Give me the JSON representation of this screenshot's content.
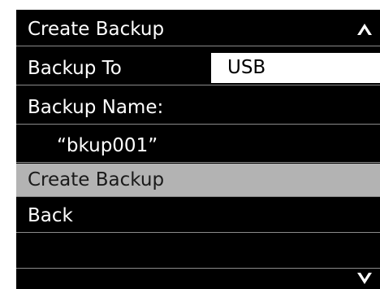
{
  "menu": {
    "title": "Create Backup",
    "rows": {
      "backup_to": {
        "label": "Backup To",
        "value": "USB"
      },
      "backup_name": {
        "label": "Backup Name:",
        "value": "“bkup001”"
      },
      "create_backup": {
        "label": "Create Backup"
      },
      "back": {
        "label": "Back"
      }
    }
  },
  "icons": {
    "scroll_up": "chevron-up-icon",
    "scroll_down": "chevron-down-icon"
  },
  "colors": {
    "background": "#000000",
    "text": "#ffffff",
    "selected_row": "#b3b3b3",
    "value_box": "#ffffff",
    "divider": "#8a8a8a"
  }
}
